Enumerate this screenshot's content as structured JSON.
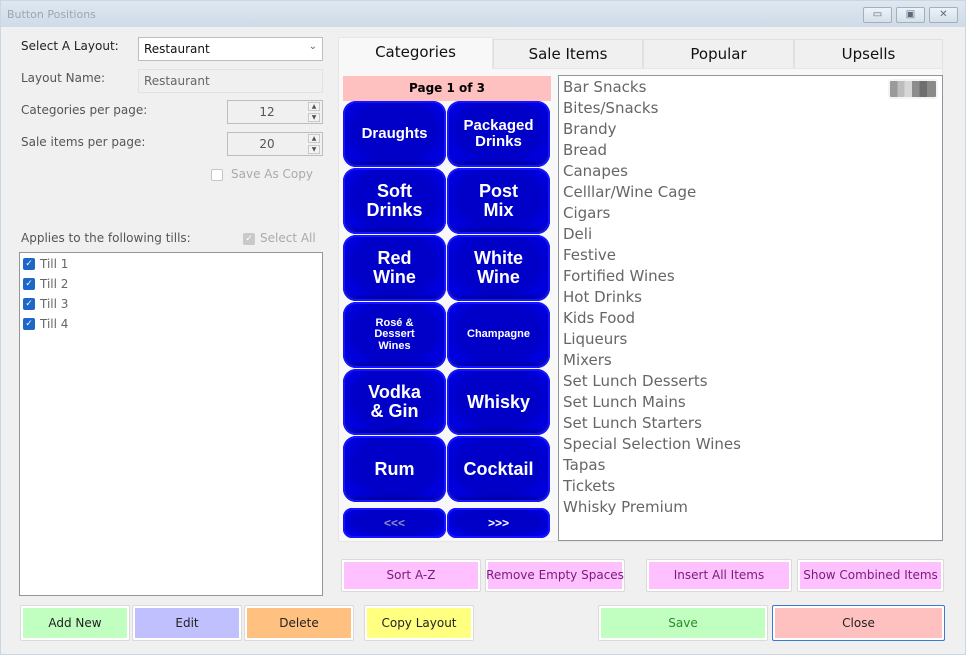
{
  "window": {
    "title": "Button Positions",
    "controls": {
      "minimize": "▭",
      "maximize": "▣",
      "close": "✕"
    }
  },
  "settings": {
    "select_layout_label": "Select A Layout:",
    "select_layout_value": "Restaurant",
    "layout_name_label": "Layout Name:",
    "layout_name_value": "Restaurant",
    "categories_per_page_label": "Categories per page:",
    "categories_per_page_value": "12",
    "sale_items_per_page_label": "Sale items per page:",
    "sale_items_per_page_value": "20",
    "save_as_copy_label": "Save As Copy",
    "save_as_copy_checked": false
  },
  "tills": {
    "label": "Applies to the following tills:",
    "select_all_label": "Select All",
    "select_all_checked": true,
    "items": [
      {
        "label": "Till 1",
        "checked": true
      },
      {
        "label": "Till 2",
        "checked": true
      },
      {
        "label": "Till 3",
        "checked": true
      },
      {
        "label": "Till 4",
        "checked": true
      }
    ]
  },
  "tabs": [
    {
      "label": "Categories",
      "active": true
    },
    {
      "label": "Sale Items",
      "active": false
    },
    {
      "label": "Popular",
      "active": false
    },
    {
      "label": "Upsells",
      "active": false
    }
  ],
  "categories_panel": {
    "page_indicator": "Page 1 of 3",
    "buttons": [
      {
        "label": "Draughts"
      },
      {
        "label": "Packaged\nDrinks"
      },
      {
        "label": "Soft\nDrinks"
      },
      {
        "label": "Post\nMix"
      },
      {
        "label": "Red\nWine"
      },
      {
        "label": "White\nWine"
      },
      {
        "label": "Rosé &\nDessert\nWines"
      },
      {
        "label": "Champagne"
      },
      {
        "label": "Vodka\n& Gin"
      },
      {
        "label": "Whisky"
      },
      {
        "label": "Rum"
      },
      {
        "label": "Cocktail"
      }
    ],
    "prev_label": "<<<",
    "next_label": ">>>",
    "category_list": [
      "Bar Snacks",
      "Bites/Snacks",
      "Brandy",
      "Bread",
      "Canapes",
      "Celllar/Wine Cage",
      "Cigars",
      "Deli",
      "Festive",
      "Fortified Wines",
      "Hot Drinks",
      "Kids Food",
      "Liqueurs",
      "Mixers",
      "Set Lunch Desserts",
      "Set Lunch Mains",
      "Set Lunch Starters",
      "Special Selection Wines",
      "Tapas",
      "Tickets",
      "Whisky Premium"
    ]
  },
  "actions": {
    "sort_az": "Sort A-Z",
    "remove_empty": "Remove Empty Spaces",
    "insert_all": "Insert All Items",
    "show_combined": "Show Combined Items",
    "add_new": "Add New",
    "edit": "Edit",
    "delete": "Delete",
    "copy_layout": "Copy Layout",
    "save": "Save",
    "close": "Close"
  },
  "colors": {
    "category_button": "#0000cc",
    "page_bar": "#ffc0c0",
    "tool_button": "#ffc0ff",
    "add_new": "#c0ffc0",
    "edit": "#c0c0ff",
    "delete": "#ffc080",
    "copy_layout": "#ffff80",
    "save": "#c0ffc0",
    "close": "#ffc0c0"
  }
}
